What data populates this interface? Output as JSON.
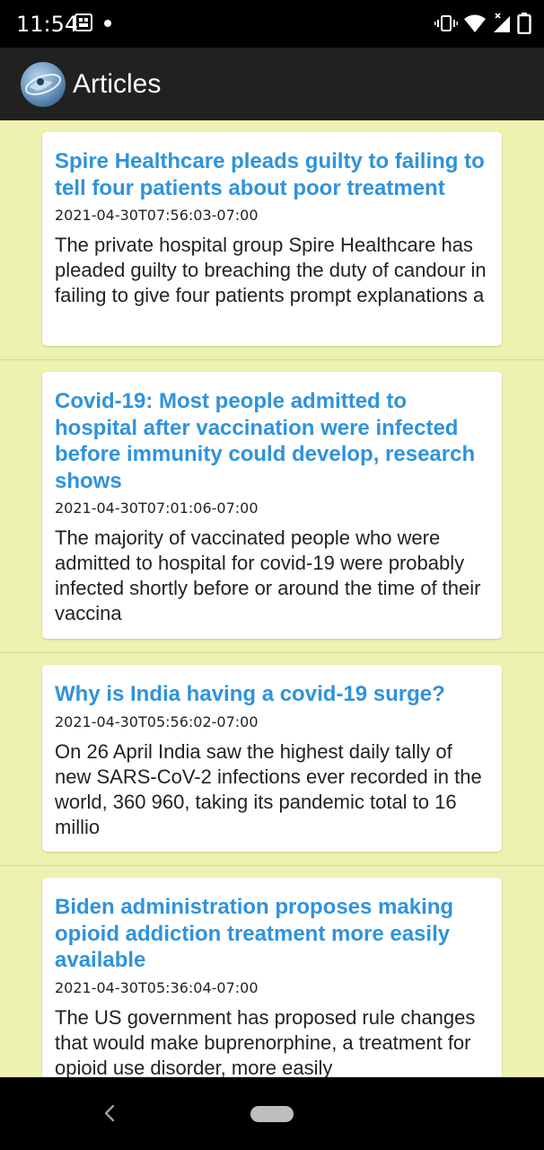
{
  "status_bar": {
    "time": "11:54"
  },
  "app_bar": {
    "title": "Articles"
  },
  "articles": [
    {
      "title": "Spire Healthcare pleads guilty to failing to tell four patients about poor treatment",
      "date": "2021-04-30T07:56:03-07:00",
      "summary": "The private hospital group Spire Healthcare has pleaded guilty to breaching the duty of candour in failing to give four patients prompt explanations a"
    },
    {
      "title": "Covid-19: Most people admitted to hospital after vaccination were infected before immunity could develop, research shows",
      "date": "2021-04-30T07:01:06-07:00",
      "summary": "The majority of vaccinated people who were admitted to hospital for covid-19 were probably infected shortly before or around the time of their vaccina"
    },
    {
      "title": "Why is India having a covid-19 surge?",
      "date": "2021-04-30T05:56:02-07:00",
      "summary": "On 26 April India saw the highest daily tally of new SARS-CoV-2 infections ever recorded in the world, 360 960, taking its pandemic total to 16 millio"
    },
    {
      "title": "Biden administration proposes making opioid addiction treatment more easily available",
      "date": "2021-04-30T05:36:04-07:00",
      "summary": "The US government has proposed rule changes that would make buprenorphine, a treatment for opioid use disorder, more easily"
    }
  ],
  "colors": {
    "background": "#eef2b0",
    "title_link": "#2f93dc",
    "app_bar": "#212121"
  }
}
